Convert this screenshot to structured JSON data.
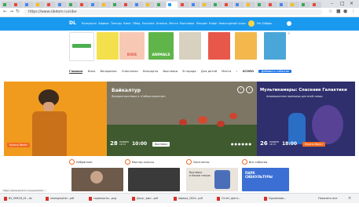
{
  "browser": {
    "url": "https://www.sibdom.ru/sibe",
    "window_controls": [
      "–",
      "□",
      "×"
    ]
  },
  "site": {
    "logo": "DL",
    "nav_items": [
      "Концерты",
      "Афиша",
      "Театры",
      "Кино",
      "Обед",
      "Уличная",
      "Анонсы",
      "Места",
      "Выставка",
      "Лекции",
      "Кафе",
      "Новогодний пульс"
    ],
    "user_text": "На Сибирь",
    "promo_books": [
      "KIDS",
      "ANIMALS"
    ]
  },
  "subnav": {
    "items": [
      "Главное",
      "Кино",
      "Вечеринки",
      "Спектакли",
      "Концерты",
      "Выставки",
      "В городе",
      "Для детей",
      "Места"
    ],
    "scoro": "SCORO",
    "add_button": "Добавить событие"
  },
  "hero": {
    "left": {
      "button": "Купить билет"
    },
    "mid": {
      "title": "Байкалтур",
      "subtitle": "Ярмарка выставка в «Сибэкспоцентре»",
      "day": "28",
      "month": "НОЯБРЯ\n18 ЧТ",
      "time": "10:00",
      "button": "Выставка",
      "arrow_left": "‹",
      "arrow_right": "›"
    },
    "right": {
      "title": "Мультикамеры: Спасение Галактики",
      "subtitle": "Анимационная премьера для всей семьи",
      "day": "26",
      "month": "НОЯБРЯ\n18 ЧТ",
      "time": "18:00",
      "button": "Купить билет"
    }
  },
  "filters": [
    "Избранное",
    "Мастер-классы",
    "Бесплатно",
    "Все события"
  ],
  "cards": [
    {
      "text": ""
    },
    {
      "text": ""
    },
    {
      "text": ""
    },
    {
      "text": "Выставка\nв Малом театре"
    },
    {
      "text": "ПАРК\nСИБКУЛЬТУРЫ"
    }
  ],
  "downloads": [
    "BV_NYK18_01...ds",
    "seamgrapher...pdf",
    "скриншоты...png",
    "Досуг_вып...pdf",
    "Афиша_2024...pdf",
    "Отчёт_фото...",
    "Нурманова..."
  ],
  "download_bar": {
    "show_all": "Показать все",
    "close": "×"
  },
  "status_url": "https://www.sibdom.ru/events/52/..."
}
